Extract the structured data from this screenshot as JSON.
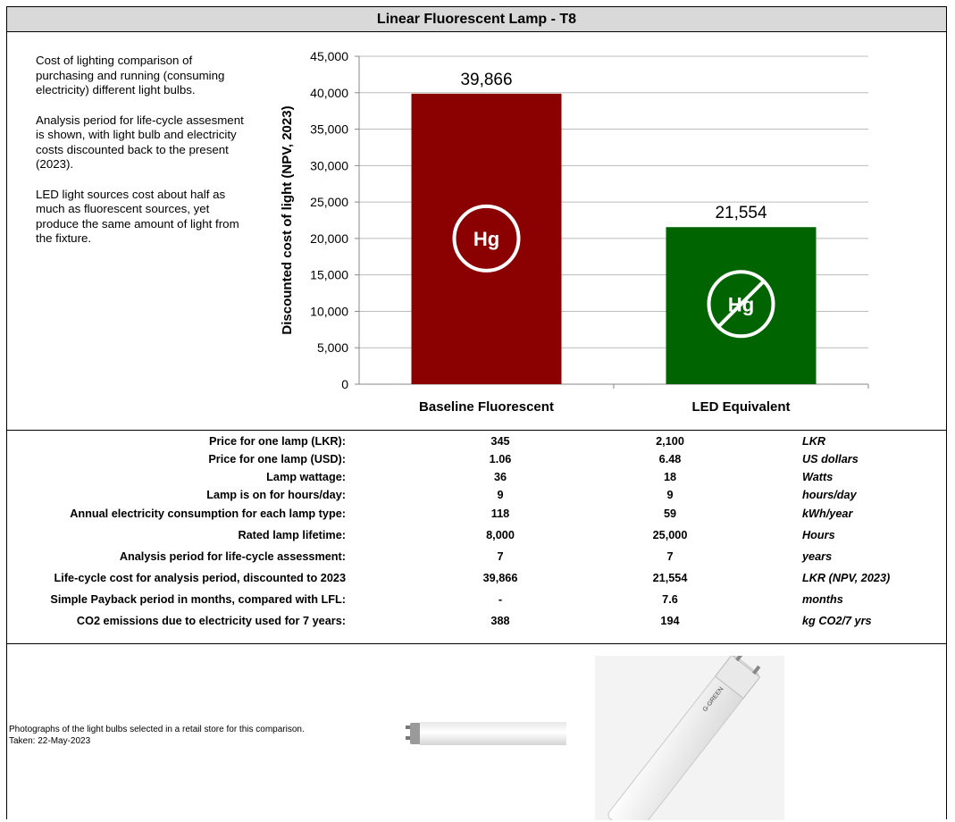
{
  "title": "Linear Fluorescent Lamp - T8",
  "description": [
    "Cost of lighting comparison of purchasing and running (consuming electricity) different light bulbs.",
    "Analysis period for life-cycle assesment is shown, with light bulb and electricity costs discounted back to the present (2023).",
    "LED light sources cost about half as much as fluorescent sources, yet produce the same amount of light from the fixture."
  ],
  "chart_data": {
    "type": "bar",
    "categories": [
      "Baseline Fluorescent",
      "LED Equivalent"
    ],
    "values": [
      39866,
      21554
    ],
    "value_labels": [
      "39,866",
      "21,554"
    ],
    "ylabel": "Discounted cost of light  (NPV, 2023)",
    "ylim": [
      0,
      45000
    ],
    "yticks": [
      0,
      5000,
      10000,
      15000,
      20000,
      25000,
      30000,
      35000,
      40000,
      45000
    ],
    "ytick_labels": [
      "0",
      "5,000",
      "10,000",
      "15,000",
      "20,000",
      "25,000",
      "30,000",
      "35,000",
      "40,000",
      "45,000"
    ],
    "grid": true,
    "colors": [
      "#8b0000",
      "#006400"
    ],
    "badges": [
      "Hg",
      "Hg"
    ],
    "badge_icons": [
      "mercury-circle-icon",
      "no-mercury-icon"
    ]
  },
  "table": [
    {
      "label": "Price for one lamp (LKR):",
      "v1": "345",
      "v2": "2,100",
      "unit": "LKR"
    },
    {
      "label": "Price for one lamp (USD):",
      "v1": "1.06",
      "v2": "6.48",
      "unit": "US dollars"
    },
    {
      "label": "Lamp wattage:",
      "v1": "36",
      "v2": "18",
      "unit": "Watts"
    },
    {
      "label": "Lamp is on for hours/day:",
      "v1": "9",
      "v2": "9",
      "unit": "hours/day"
    },
    {
      "label": "Annual electricity consumption for each lamp type:",
      "v1": "118",
      "v2": "59",
      "unit": "kWh/year"
    },
    {
      "label": "Rated lamp lifetime:",
      "v1": "8,000",
      "v2": "25,000",
      "unit": "Hours"
    },
    {
      "label": "Analysis period for life-cycle assessment:",
      "v1": "7",
      "v2": "7",
      "unit": "years"
    },
    {
      "label": "Life-cycle cost for analysis period, discounted to 2023",
      "v1": "39,866",
      "v2": "21,554",
      "unit": "LKR (NPV, 2023)"
    },
    {
      "label": "Simple Payback period in months, compared with LFL:",
      "v1": "-",
      "v2": "7.6",
      "unit": "months"
    },
    {
      "label": "CO2 emissions due to electricity used for 7 years:",
      "v1": "388",
      "v2": "194",
      "unit": "kg CO2/7 yrs"
    }
  ],
  "photos": {
    "caption_line1": "Photographs of the light bulbs selected in a retail store for this comparison.",
    "caption_line2": "Taken: 22-May-2023",
    "brand_label": "G-GREEN"
  }
}
